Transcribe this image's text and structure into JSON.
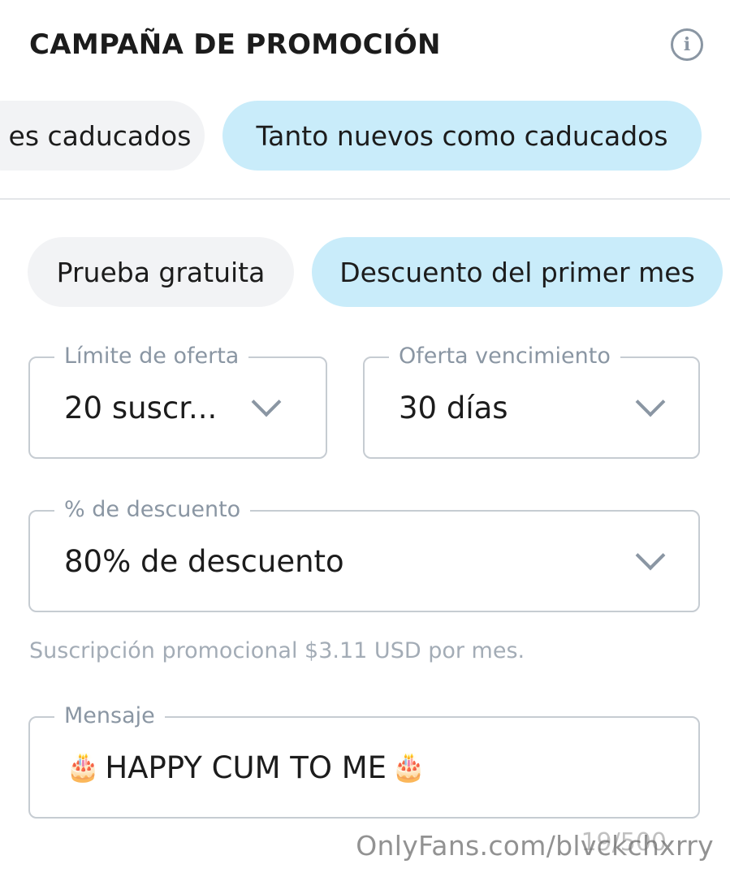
{
  "header": {
    "title": "CAMPAÑA DE PROMOCIÓN",
    "info_icon": "info-icon"
  },
  "audience_tabs": [
    {
      "label": "es caducados",
      "active": false
    },
    {
      "label": "Tanto nuevos como caducados",
      "active": true
    }
  ],
  "offer_type_tabs": [
    {
      "label": "Prueba gratuita",
      "active": false
    },
    {
      "label": "Descuento del primer mes",
      "active": true
    }
  ],
  "fields": {
    "offer_limit": {
      "label": "Límite de oferta",
      "value": "20 suscr..."
    },
    "offer_expiration": {
      "label": "Oferta vencimiento",
      "value": "30 días"
    },
    "discount": {
      "label": "% de descuento",
      "value": "80% de descuento"
    },
    "message": {
      "label": "Mensaje",
      "value": "HAPPY CUM TO ME",
      "emoji": "🎂"
    }
  },
  "helper_text": "Suscripción promocional $3.11 USD por mes.",
  "message_counter": "19/500",
  "watermark": "OnlyFans.com/blvckchxrry",
  "colors": {
    "active_pill": "#c9ecfa",
    "inactive_pill": "#f2f3f5",
    "muted_text": "#8a96a3"
  }
}
